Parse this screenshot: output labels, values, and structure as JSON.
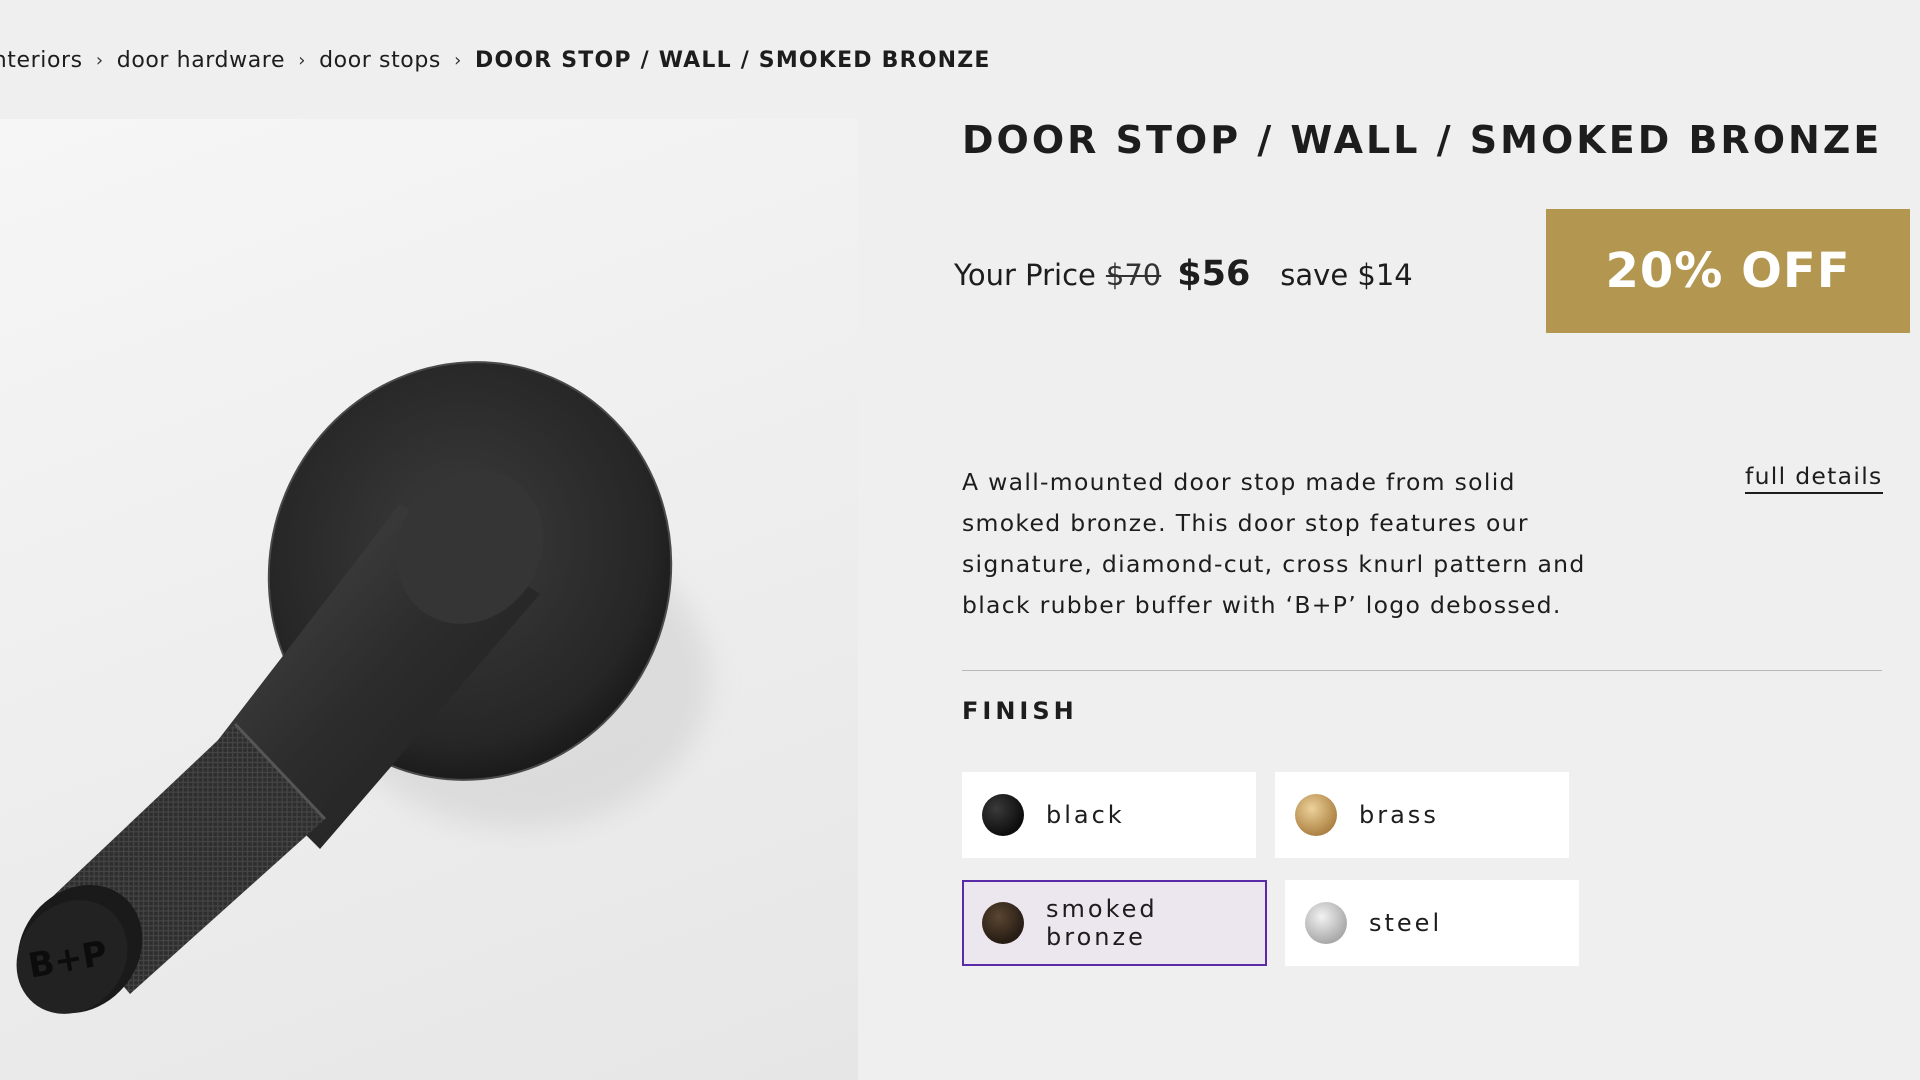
{
  "breadcrumb": {
    "items": [
      "interiors",
      "door hardware",
      "door stops"
    ],
    "current": "DOOR STOP / WALL / SMOKED BRONZE",
    "separator": "›"
  },
  "product": {
    "title": "DOOR STOP / WALL / SMOKED BRONZE",
    "image_logo_text": "B+P"
  },
  "price": {
    "label": "Your Price",
    "original": "$70",
    "current": "$56",
    "savings": "save $14",
    "discount_badge": "20% OFF",
    "badge_color": "#b39750"
  },
  "description": {
    "text": "A wall-mounted door stop made from solid smoked bronze. This door stop features our signature, diamond-cut, cross knurl pattern and black rubber buffer with ‘B+P’ logo debossed.",
    "link": "full details"
  },
  "finish": {
    "label": "FINISH",
    "options": [
      {
        "name": "black",
        "color": "#1a1a1a",
        "selected": false
      },
      {
        "name": "brass",
        "color": "#c9a466",
        "selected": false
      },
      {
        "name": "smoked bronze",
        "color": "#2d2219",
        "selected": true
      },
      {
        "name": "steel",
        "color": "#c4c4c4",
        "selected": false
      }
    ],
    "selected_border_color": "#5b2aa6"
  }
}
